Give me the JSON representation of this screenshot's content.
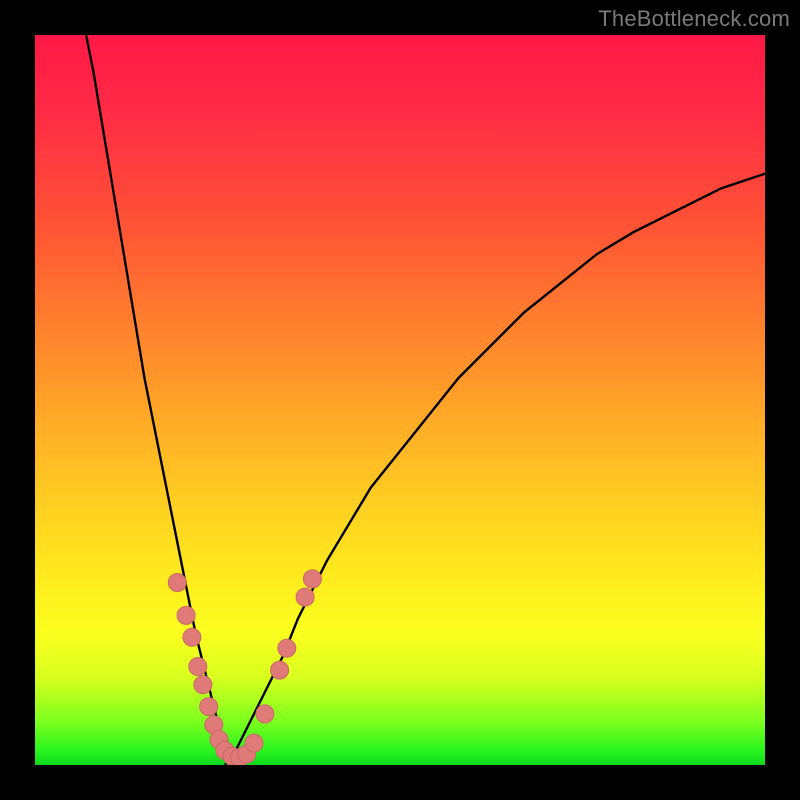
{
  "attribution": "TheBottleneck.com",
  "colors": {
    "frame": "#000000",
    "curve": "#000000",
    "marker_fill": "#e07a78",
    "marker_stroke": "#c96865",
    "gradient_stops": [
      "#ff1846",
      "#ff2a46",
      "#ff5036",
      "#ff7a2e",
      "#ffa128",
      "#ffc822",
      "#ffe81e",
      "#fbff1e",
      "#d8ff1e",
      "#7dff1e",
      "#29f51e",
      "#0ed81e"
    ]
  },
  "chart_data": {
    "type": "line",
    "title": "",
    "xlabel": "",
    "ylabel": "",
    "xlim": [
      0,
      100
    ],
    "ylim": [
      0,
      100
    ],
    "notes": "Axes unlabeled; values are relative percentages of the plot area. Two black curves meet at a minimum around x≈26. Salmon-colored markers cluster near the minimum on both branches. Background is a red→green vertical gradient.",
    "series": [
      {
        "name": "left-curve",
        "x": [
          7,
          8,
          9,
          10,
          11,
          12,
          13,
          14,
          15,
          16,
          17,
          18,
          19,
          20,
          21,
          22,
          23,
          24,
          25,
          26,
          27,
          28
        ],
        "values": [
          100,
          95,
          89,
          83,
          77,
          71,
          65,
          59,
          53,
          48,
          43,
          38,
          33,
          28,
          23,
          18,
          14,
          10,
          6,
          3,
          1,
          0
        ]
      },
      {
        "name": "right-curve",
        "x": [
          26,
          27,
          28,
          30,
          32,
          34,
          36,
          38,
          40,
          43,
          46,
          50,
          54,
          58,
          62,
          67,
          72,
          77,
          82,
          88,
          94,
          100
        ],
        "values": [
          0,
          1,
          3,
          7,
          11,
          15,
          20,
          24,
          28,
          33,
          38,
          43,
          48,
          53,
          57,
          62,
          66,
          70,
          73,
          76,
          79,
          81
        ]
      }
    ],
    "markers": {
      "name": "highlighted-points",
      "color": "#e07a78",
      "points": [
        {
          "x": 19.5,
          "y": 25.0
        },
        {
          "x": 20.7,
          "y": 20.5
        },
        {
          "x": 21.5,
          "y": 17.5
        },
        {
          "x": 22.3,
          "y": 13.5
        },
        {
          "x": 23.0,
          "y": 11.0
        },
        {
          "x": 23.8,
          "y": 8.0
        },
        {
          "x": 24.5,
          "y": 5.5
        },
        {
          "x": 25.2,
          "y": 3.5
        },
        {
          "x": 26.0,
          "y": 2.0
        },
        {
          "x": 27.0,
          "y": 1.2
        },
        {
          "x": 28.0,
          "y": 1.0
        },
        {
          "x": 29.0,
          "y": 1.5
        },
        {
          "x": 30.0,
          "y": 3.0
        },
        {
          "x": 31.5,
          "y": 7.0
        },
        {
          "x": 33.5,
          "y": 13.0
        },
        {
          "x": 34.5,
          "y": 16.0
        },
        {
          "x": 37.0,
          "y": 23.0
        },
        {
          "x": 38.0,
          "y": 25.5
        }
      ]
    }
  }
}
